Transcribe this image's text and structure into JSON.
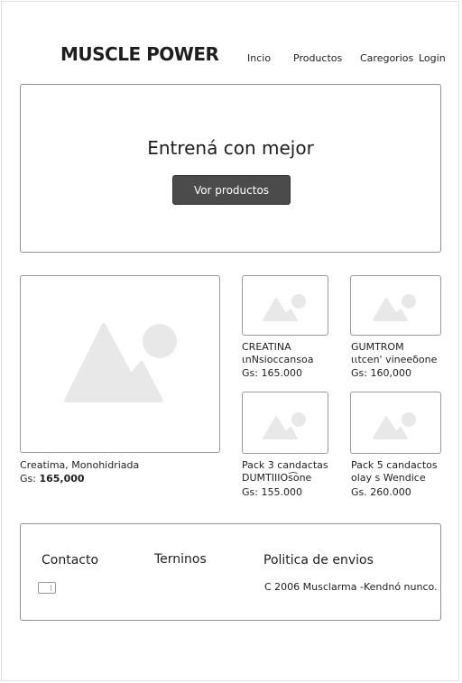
{
  "header": {
    "brand": "MUSCLE POWER",
    "nav": [
      {
        "label": "Incio"
      },
      {
        "label": "Productos"
      },
      {
        "label": "Caregorios"
      },
      {
        "label": "Login"
      }
    ]
  },
  "hero": {
    "title": "Entrená con mejor",
    "button_label": "Vor productos"
  },
  "products": {
    "featured": {
      "name": "Creatima, Monohidriada",
      "price_prefix": "Gs:",
      "price": "165,000"
    },
    "items": [
      {
        "name_line1": "CREATINA",
        "name_line2": "ιnNsioccansoa",
        "price": "Gs: 165.000"
      },
      {
        "name_line1": "GUMTROM",
        "name_line2": "ιιtcen' vineeδone",
        "price": "Gs: 160,000"
      },
      {
        "name_line1": "Pack 3 candactas",
        "name_line2": "DUMTIIIOs͡one",
        "price": "Gs: 155.000"
      },
      {
        "name_line1": "Pack 5 candactos",
        "name_line2": "olay s Wendice",
        "price": "Gs. 260.000"
      }
    ]
  },
  "footer": {
    "contact": "Contacto",
    "terms": "Terninos",
    "shipping": "Politica de envios",
    "copyright": "C 2006 Musclarma -Kendnó nunco.",
    "icons": [
      "card-icon"
    ]
  },
  "colors": {
    "button_bg": "#4b4b4b",
    "border": "#8f8f8f",
    "placeholder": "#e8e8e8"
  }
}
